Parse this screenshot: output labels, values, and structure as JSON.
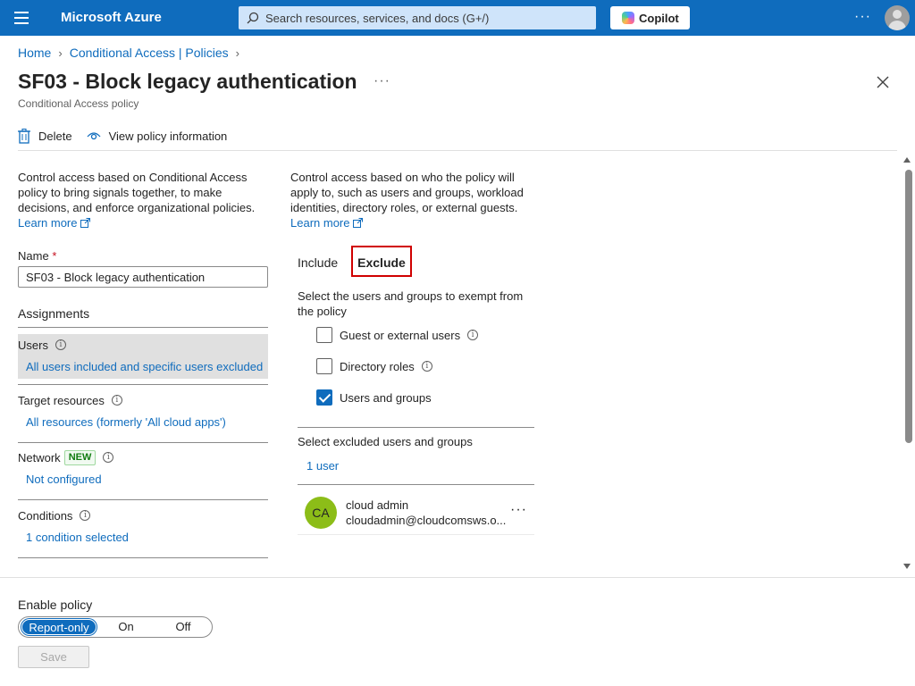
{
  "topbar": {
    "menu_icon": "hamburger-icon",
    "brand": "Microsoft Azure",
    "search_placeholder": "Search resources, services, and docs (G+/)",
    "copilot_label": "Copilot",
    "more_icon": "ellipsis-icon",
    "avatar_icon": "user-avatar-icon"
  },
  "breadcrumb": {
    "items": [
      "Home",
      "Conditional Access | Policies"
    ]
  },
  "header": {
    "title": "SF03 - Block legacy authentication",
    "subtitle": "Conditional Access policy",
    "more": "···"
  },
  "command_bar": {
    "delete_label": "Delete",
    "view_info_label": "View policy information"
  },
  "left": {
    "description": "Control access based on Conditional Access policy to bring signals together, to make decisions, and enforce organizational policies.",
    "learn_more": "Learn more",
    "name_label": "Name",
    "name_value": "SF03 - Block legacy authentication",
    "assignments_heading": "Assignments",
    "sections": [
      {
        "label": "Users",
        "value": "All users included and specific users excluded"
      },
      {
        "label": "Target resources",
        "value": "All resources (formerly 'All cloud apps')"
      },
      {
        "label": "Network",
        "badge": "NEW",
        "value": "Not configured"
      },
      {
        "label": "Conditions",
        "value": "1 condition selected"
      }
    ]
  },
  "right": {
    "description": "Control access based on who the policy will apply to, such as users and groups, workload identities, directory roles, or external guests.",
    "learn_more": "Learn more",
    "tabs": {
      "include": "Include",
      "exclude": "Exclude",
      "selected": "exclude"
    },
    "exclude_description": "Select the users and groups to exempt from the policy",
    "options": [
      {
        "label": "Guest or external users",
        "checked": false
      },
      {
        "label": "Directory roles",
        "checked": false
      },
      {
        "label": "Users and groups",
        "checked": true
      }
    ],
    "select_excluded_label": "Select excluded users and groups",
    "selected_count": "1 user",
    "user": {
      "initials": "CA",
      "name": "cloud admin",
      "email": "cloudadmin@cloudcomsws.o...",
      "avatar_color": "#8cbd18"
    }
  },
  "footer": {
    "enable_label": "Enable policy",
    "options": [
      "Report-only",
      "On",
      "Off"
    ],
    "selected": "Report-only",
    "save_label": "Save"
  },
  "colors": {
    "brand": "#0f6cbd",
    "highlight_border": "#d00000"
  }
}
